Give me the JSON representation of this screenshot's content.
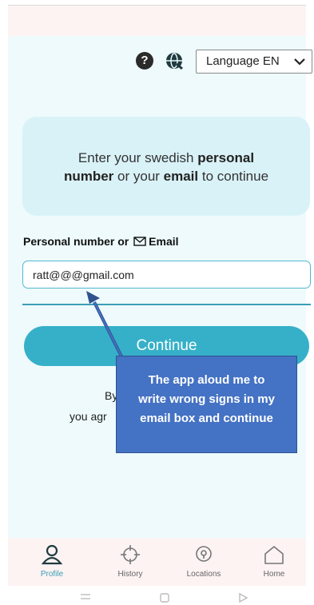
{
  "toolbar": {
    "help_icon": "help-circle-icon",
    "globe_icon": "globe-icon",
    "language_label": "Language EN"
  },
  "info_card": {
    "line1_prefix": "Enter your swedish ",
    "line1_bold": "personal",
    "line2_bold_a": "number",
    "line2_mid": " or your ",
    "line2_bold_b": "email",
    "line2_suffix": " to continue"
  },
  "form": {
    "label_prefix": "Personal number or",
    "label_suffix": "Email",
    "email_value": "ratt@@@gmail.com",
    "continue_label": "Continue"
  },
  "terms": {
    "line1": "By",
    "line2": "you agr"
  },
  "annotation": {
    "line1": "The app aloud me to",
    "line2": "write wrong signs in my",
    "line3": "email box and continue"
  },
  "bottom_nav": [
    {
      "label": "Profile",
      "icon": "person-icon",
      "active": true
    },
    {
      "label": "History",
      "icon": "crosshair-icon",
      "active": false
    },
    {
      "label": "Locations",
      "icon": "location-pin-icon",
      "active": false
    },
    {
      "label": "Home",
      "icon": "home-icon",
      "active": false
    }
  ],
  "colors": {
    "accent": "#36b0c9",
    "app_background": "#eefafc",
    "card_background": "#d9f2f7",
    "annotation_fill": "#4472c4"
  }
}
